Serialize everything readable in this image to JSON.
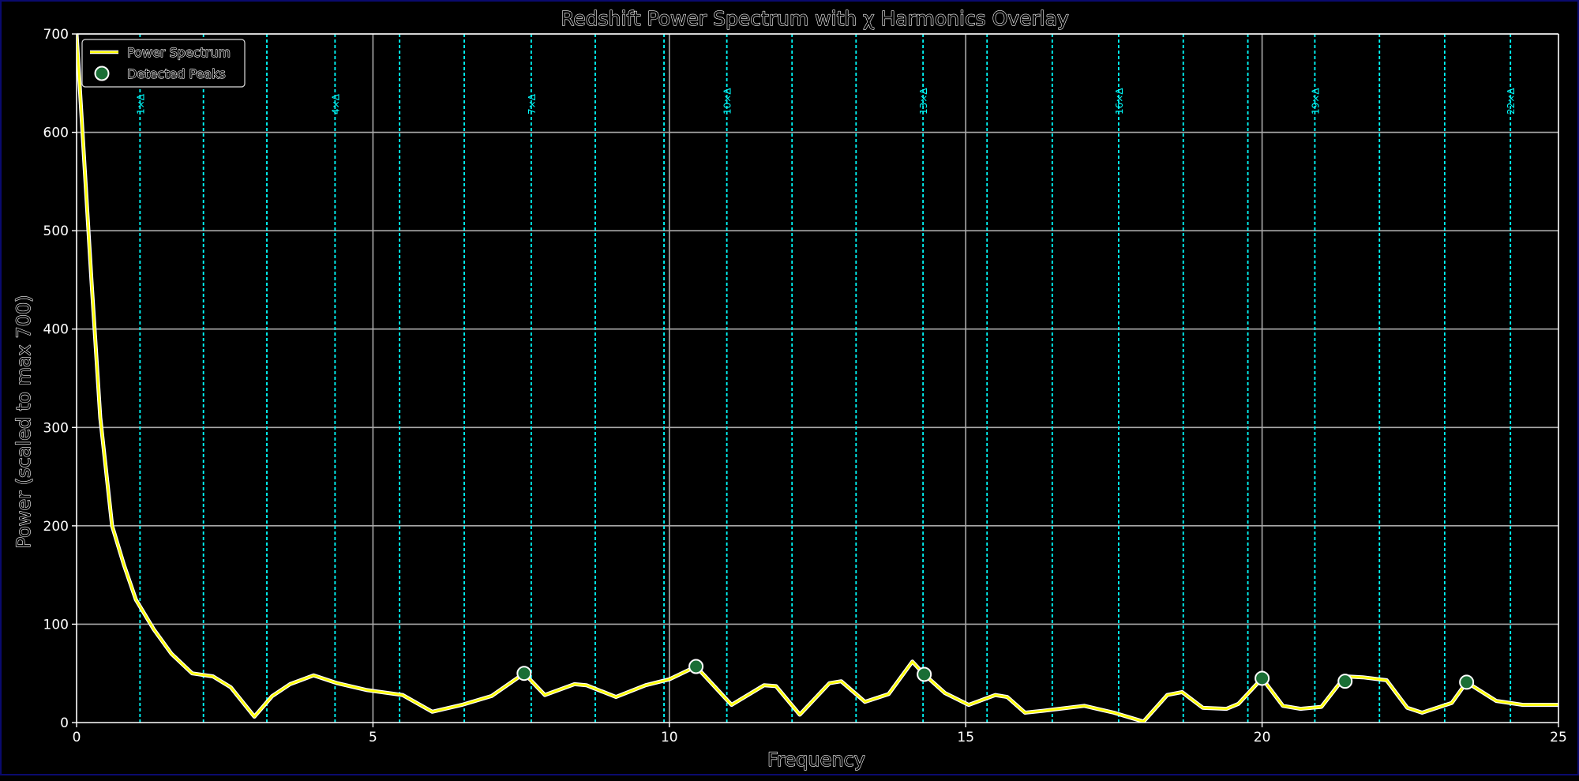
{
  "chart_data": {
    "type": "line",
    "title": "Redshift Power Spectrum with χ Harmonics Overlay",
    "xlabel": "Frequency",
    "ylabel": "Power (scaled to max 700)",
    "xlim": [
      0,
      25
    ],
    "ylim": [
      0,
      700
    ],
    "xticks": [
      0,
      5,
      10,
      15,
      20,
      25
    ],
    "yticks": [
      0,
      100,
      200,
      300,
      400,
      500,
      600,
      700
    ],
    "grid": true,
    "legend_position": "upper-left",
    "legend": [
      {
        "label": "Power Spectrum",
        "kind": "line"
      },
      {
        "label": "Detected Peaks",
        "kind": "marker"
      }
    ],
    "series": [
      {
        "name": "Power Spectrum",
        "color": "#ffff00",
        "x": [
          0.0,
          0.1,
          0.25,
          0.4,
          0.6,
          0.8,
          1.0,
          1.3,
          1.6,
          1.95,
          2.3,
          2.6,
          3.0,
          3.3,
          3.6,
          4.0,
          4.4,
          4.9,
          5.5,
          6.0,
          6.5,
          7.0,
          7.55,
          7.9,
          8.4,
          8.6,
          9.1,
          9.6,
          10.0,
          10.45,
          11.05,
          11.6,
          11.8,
          12.2,
          12.7,
          12.9,
          13.3,
          13.7,
          14.1,
          14.3,
          14.65,
          15.05,
          15.5,
          15.7,
          16.0,
          16.3,
          17.0,
          17.5,
          18.0,
          18.4,
          18.65,
          19.0,
          19.4,
          19.6,
          20.0,
          20.35,
          20.65,
          21.0,
          21.4,
          21.7,
          22.1,
          22.45,
          22.7,
          23.2,
          23.45,
          23.95,
          24.4,
          25.0
        ],
        "values": [
          700,
          600,
          450,
          310,
          200,
          160,
          125,
          95,
          70,
          50,
          47,
          36,
          6,
          27,
          39,
          48,
          40,
          33,
          28,
          11,
          18,
          27,
          50,
          28,
          39,
          38,
          26,
          38,
          44,
          57,
          18,
          38,
          37,
          8,
          40,
          42,
          21,
          29,
          62,
          49,
          30,
          18,
          28,
          26,
          10,
          12,
          17,
          10,
          1,
          28,
          31,
          15,
          14,
          19,
          45,
          17,
          14,
          16,
          47,
          46,
          43,
          15,
          10,
          20,
          41,
          22,
          18,
          18
        ]
      }
    ],
    "peaks": {
      "name": "Detected Peaks",
      "x": [
        7.55,
        10.45,
        14.3,
        20.0,
        21.4,
        23.45
      ],
      "values": [
        50,
        57,
        49,
        45,
        42,
        41
      ]
    },
    "harmonics": {
      "color": "#00ffff",
      "lines": [
        {
          "x": 1.07,
          "label": "1×Δ"
        },
        {
          "x": 2.14,
          "label": ""
        },
        {
          "x": 3.21,
          "label": ""
        },
        {
          "x": 4.36,
          "label": "4×Δ"
        },
        {
          "x": 5.45,
          "label": ""
        },
        {
          "x": 6.54,
          "label": ""
        },
        {
          "x": 7.67,
          "label": "7×Δ"
        },
        {
          "x": 8.75,
          "label": ""
        },
        {
          "x": 9.91,
          "label": ""
        },
        {
          "x": 10.97,
          "label": "10×Δ"
        },
        {
          "x": 12.07,
          "label": ""
        },
        {
          "x": 13.15,
          "label": ""
        },
        {
          "x": 14.28,
          "label": "13×Δ"
        },
        {
          "x": 15.36,
          "label": ""
        },
        {
          "x": 16.46,
          "label": ""
        },
        {
          "x": 17.58,
          "label": "16×Δ"
        },
        {
          "x": 18.67,
          "label": ""
        },
        {
          "x": 19.76,
          "label": ""
        },
        {
          "x": 20.89,
          "label": "19×Δ"
        },
        {
          "x": 21.98,
          "label": ""
        },
        {
          "x": 23.08,
          "label": ""
        },
        {
          "x": 24.19,
          "label": "22×Δ"
        }
      ]
    }
  }
}
